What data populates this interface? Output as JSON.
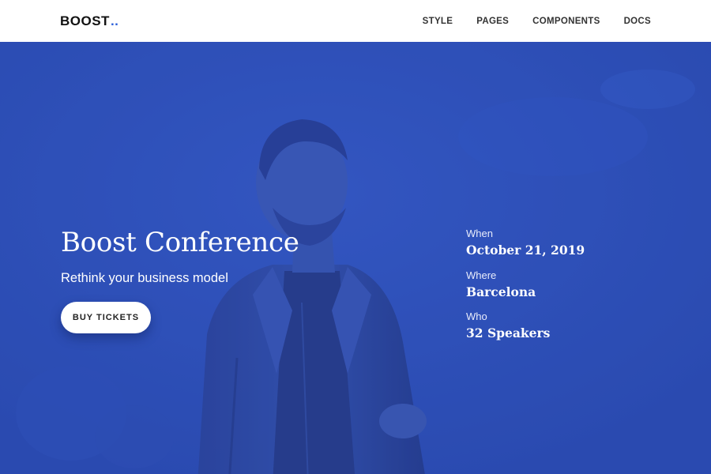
{
  "navbar": {
    "brand": "BOOST",
    "brand_dots": "..",
    "links": [
      "STYLE",
      "PAGES",
      "COMPONENTS",
      "DOCS"
    ]
  },
  "hero": {
    "title": "Boost Conference",
    "subtitle": "Rethink your business model",
    "cta_label": "BUY TICKETS",
    "background_image": "speaker-on-stage-photo",
    "overlay_color": "#2c4fb8",
    "event_info": [
      {
        "label": "When",
        "value": "October 21, 2019"
      },
      {
        "label": "Where",
        "value": "Barcelona"
      },
      {
        "label": "Who",
        "value": "32 Speakers"
      }
    ]
  },
  "colors": {
    "accent": "#2b5fd9",
    "hero_overlay": "#2c4fb8",
    "navbar_bg": "#ffffff"
  }
}
